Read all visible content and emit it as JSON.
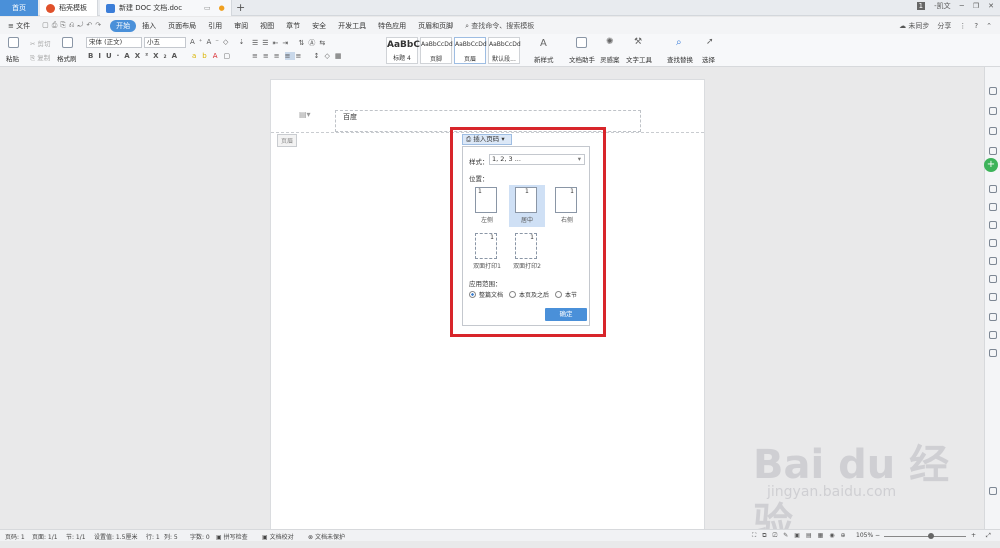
{
  "tabs": {
    "home": "首页",
    "template": "稻壳模板",
    "document": "新建 DOC 文档.doc",
    "add": "+"
  },
  "window": {
    "badge": "1",
    "user": "-凯文"
  },
  "menu": {
    "file": "文件",
    "items": [
      "开始",
      "插入",
      "页面布局",
      "引用",
      "审阅",
      "视图",
      "章节",
      "安全",
      "开发工具",
      "特色应用",
      "页眉和页脚"
    ],
    "active": "开始",
    "search": "查找命令、搜索模板",
    "sync": "未同步",
    "share": "分享"
  },
  "ribbon": {
    "paste": "粘贴",
    "cut": "剪切",
    "copy": "复制",
    "format_painter": "格式刷",
    "font": "宋体 (正文)",
    "size": "小五",
    "styles": [
      {
        "preview": "AaBbC",
        "name": "标题 4"
      },
      {
        "preview": "AaBbCcDd",
        "name": "页脚"
      },
      {
        "preview": "AaBbCcDd",
        "name": "页眉"
      },
      {
        "preview": "AaBbCcDd",
        "name": "默认段..."
      }
    ],
    "new_style": "新样式",
    "doc_helper": "文档助手",
    "inspiration": "灵感案",
    "text_tools": "文字工具",
    "find_replace": "查找替换",
    "select": "选择"
  },
  "document": {
    "header_text": "百度",
    "header_label": "页眉"
  },
  "dialog": {
    "insert_button": "插入页码",
    "style_label": "样式：",
    "style_value": "1, 2, 3 ...",
    "position_label": "位置：",
    "positions": [
      {
        "label": "左侧",
        "num": "1"
      },
      {
        "label": "居中",
        "num": "1"
      },
      {
        "label": "右侧",
        "num": "1"
      },
      {
        "label": "双面打印1",
        "num": "1"
      },
      {
        "label": "双面打印2",
        "num": "1"
      }
    ],
    "selected_position": "居中",
    "scope_label": "应用范围：",
    "scope_options": [
      "整篇文档",
      "本页及之后",
      "本节"
    ],
    "scope_selected": "整篇文档",
    "ok": "确定"
  },
  "status": {
    "page_num": "页码: 1",
    "pages": "页面: 1/1",
    "section": "节: 1/1",
    "setting": "设置值: 1.5厘米",
    "row": "行: 1",
    "col": "列: 5",
    "words": "字数: 0",
    "spell": "拼写检查",
    "proof": "文档校对",
    "protect": "文档未保护",
    "zoom": "105%"
  },
  "watermark": {
    "logo": "Bai du 经验",
    "url": "jingyan.baidu.com"
  }
}
